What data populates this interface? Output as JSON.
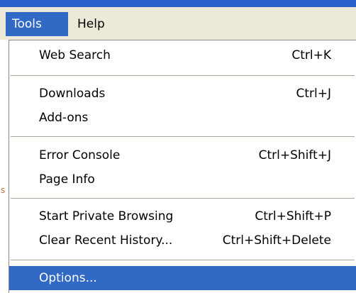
{
  "menubar": {
    "tools_label": "Tools",
    "help_label": "Help"
  },
  "menu": {
    "items": [
      {
        "label": "Web Search",
        "shortcut": "Ctrl+K"
      },
      {
        "label": "Downloads",
        "shortcut": "Ctrl+J"
      },
      {
        "label": "Add-ons",
        "shortcut": ""
      },
      {
        "label": "Error Console",
        "shortcut": "Ctrl+Shift+J"
      },
      {
        "label": "Page Info",
        "shortcut": ""
      },
      {
        "label": "Start Private Browsing",
        "shortcut": "Ctrl+Shift+P"
      },
      {
        "label": "Clear Recent History...",
        "shortcut": "Ctrl+Shift+Delete"
      },
      {
        "label": "Options...",
        "shortcut": ""
      }
    ],
    "highlighted_item": "Options..."
  },
  "colors": {
    "highlight": "#316ac5",
    "menubar_bg": "#ece9d8",
    "title_strip": "#2a5fc9"
  }
}
